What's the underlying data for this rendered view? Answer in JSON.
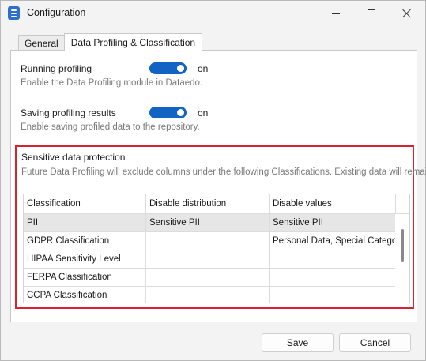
{
  "window": {
    "title": "Configuration",
    "icon": "app-icon"
  },
  "tabs": [
    {
      "label": "General",
      "active": false
    },
    {
      "label": "Data Profiling & Classification",
      "active": true
    }
  ],
  "settings": {
    "running_profiling": {
      "label": "Running profiling",
      "state": "on",
      "description": "Enable the Data Profiling module in Dataedo."
    },
    "saving_results": {
      "label": "Saving profiling results",
      "state": "on",
      "description": "Enable saving profiled data to the repository."
    }
  },
  "sensitive": {
    "title": "Sensitive data protection",
    "description": "Future Data Profiling will exclude columns under the following Classifications. Existing data will remain.",
    "columns": [
      "Classification",
      "Disable distribution",
      "Disable values"
    ],
    "rows": [
      [
        "PII",
        "Sensitive PII",
        "Sensitive PII"
      ],
      [
        "GDPR Classification",
        "",
        "Personal Data, Special Category"
      ],
      [
        "HIPAA Sensitivity Level",
        "",
        ""
      ],
      [
        "FERPA Classification",
        "",
        ""
      ],
      [
        "CCPA Classification",
        "",
        ""
      ]
    ]
  },
  "buttons": {
    "save": "Save",
    "cancel": "Cancel"
  },
  "colors": {
    "toggle": "#1363c5",
    "highlight_border": "#d6232e",
    "selected_row": "#e6e6e6"
  }
}
